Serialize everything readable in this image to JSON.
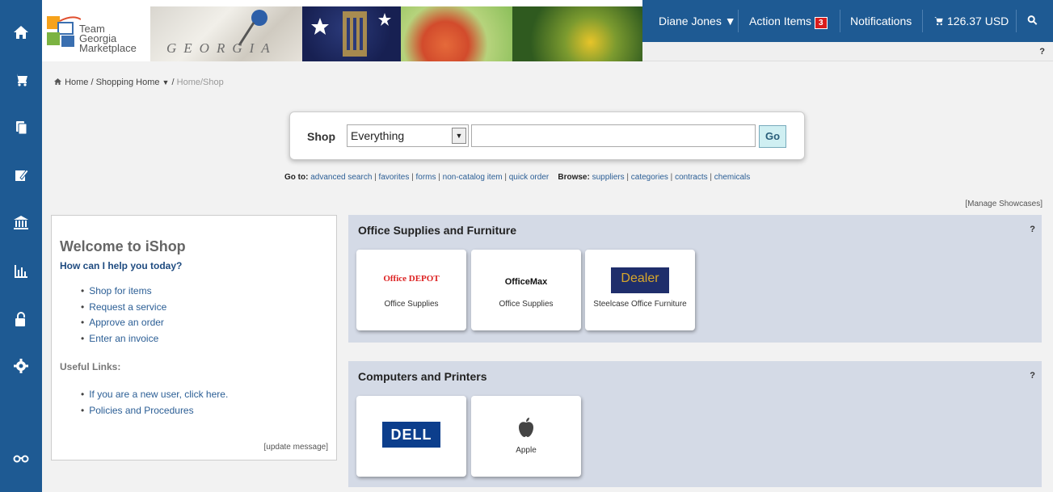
{
  "nav": {
    "items": [
      {
        "name": "home-icon"
      },
      {
        "name": "cart-icon"
      },
      {
        "name": "documents-icon"
      },
      {
        "name": "edit-icon"
      },
      {
        "name": "institution-icon"
      },
      {
        "name": "reports-icon"
      },
      {
        "name": "lock-icon"
      },
      {
        "name": "settings-icon"
      },
      {
        "name": "binoculars-icon"
      }
    ]
  },
  "banner": {
    "logo_line1": "Team",
    "logo_line2": "Georgia",
    "logo_line3": "Marketplace",
    "map_text": "GEORGIA"
  },
  "topbar": {
    "user": "Diane Jones ▼",
    "action_items": "Action Items",
    "action_count": "3",
    "notifications": "Notifications",
    "cart_total": "126.37 USD",
    "help": "?"
  },
  "breadcrumb": {
    "home": "Home",
    "shopping_home": "Shopping Home",
    "current": "Home/Shop"
  },
  "search": {
    "label": "Shop",
    "scope": "Everything",
    "go": "Go"
  },
  "goto": {
    "goto_label": "Go to:",
    "links": [
      "advanced search",
      "favorites",
      "forms",
      "non-catalog item",
      "quick order"
    ],
    "browse_label": "Browse:",
    "browse_links": [
      "suppliers",
      "categories",
      "contracts",
      "chemicals"
    ]
  },
  "manage_showcases": "[Manage Showcases]",
  "welcome": {
    "title": "Welcome to iShop",
    "subtitle": "How can I help you today?",
    "tasks": [
      "Shop for items",
      "Request a service",
      "Approve an order",
      "Enter an invoice"
    ],
    "useful_label": "Useful Links:",
    "links": [
      "If you are a new user, click here.",
      "Policies and Procedures"
    ],
    "update": "[update message]"
  },
  "showcases": [
    {
      "title": "Office Supplies and Furniture",
      "help": "?",
      "tiles": [
        {
          "logo": "Office DEPOT",
          "label": "Office Supplies"
        },
        {
          "logo": "OfficeMax",
          "label": "Office Supplies"
        },
        {
          "logo": "Dealer",
          "label": "Steelcase Office Furniture"
        }
      ]
    },
    {
      "title": "Computers and Printers",
      "help": "?",
      "tiles": [
        {
          "logo": "DELL",
          "label": ""
        },
        {
          "logo": "",
          "label": "Apple"
        }
      ]
    }
  ],
  "colors": {
    "nav_bg": "#1e5a93",
    "showcase_bg": "#d4dae6",
    "badge": "#d91c1c"
  }
}
